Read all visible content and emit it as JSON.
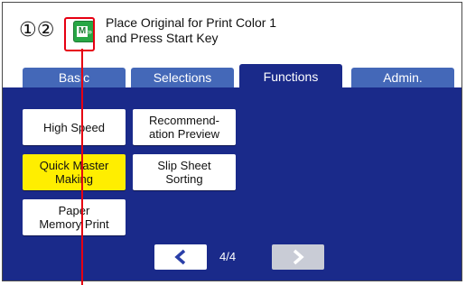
{
  "status": {
    "numbers": "①②",
    "icon_letter": "M",
    "message": "Place Original for Print Color 1\nand Press Start Key"
  },
  "tabs": [
    {
      "label": "Basic",
      "active": false
    },
    {
      "label": "Selections",
      "active": false
    },
    {
      "label": "Functions",
      "active": true
    },
    {
      "label": "Admin.",
      "active": false
    }
  ],
  "functions": [
    {
      "label": "High Speed",
      "on": false
    },
    {
      "label": "Recommend-\nation Preview",
      "on": false
    },
    {
      "label": "Quick Master\nMaking",
      "on": true
    },
    {
      "label": "Slip Sheet\nSorting",
      "on": false
    },
    {
      "label": "Paper\nMemory Print",
      "on": false
    }
  ],
  "pager": {
    "text": "4/4",
    "current": 4,
    "total": 4
  },
  "colors": {
    "panel": "#1a2a8a",
    "tab": "#4468b8",
    "selected": "#ffee00",
    "callout": "#e60012",
    "status_icon": "#28a745"
  },
  "icons": {
    "status": "master-making-icon",
    "prev": "chevron-left-icon",
    "next": "chevron-right-icon"
  }
}
